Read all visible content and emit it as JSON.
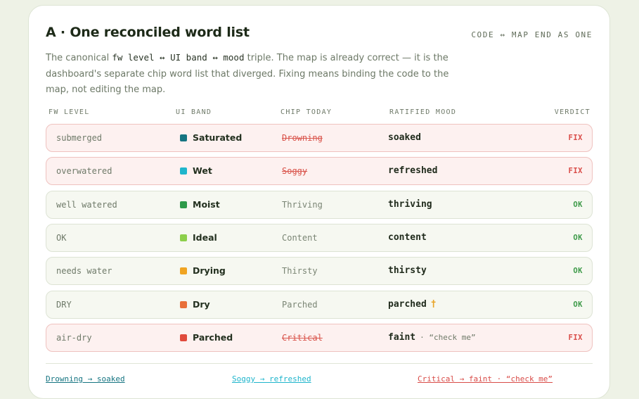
{
  "title": "A · One reconciled word list",
  "tagline": "CODE ↔ MAP END AS ONE",
  "description": {
    "pre": "The canonical ",
    "code": "fw level ↔ UI band ↔ mood",
    "post": " triple. The map is already correct — it is the dashboard's separate chip word list that diverged. Fixing means binding the code to the map, not editing the map."
  },
  "columns": {
    "fw_level": "FW LEVEL",
    "ui_band": "UI BAND",
    "chip_today": "CHIP TODAY",
    "ratified_mood": "RATIFIED MOOD",
    "verdict": "VERDICT"
  },
  "rows": [
    {
      "fw": "submerged",
      "band": "Saturated",
      "color": "#157481",
      "chip": "Drowning",
      "mood": "soaked",
      "extra": "",
      "note": "",
      "verdict": "FIX"
    },
    {
      "fw": "overwatered",
      "band": "Wet",
      "color": "#1fb5cc",
      "chip": "Soggy",
      "mood": "refreshed",
      "extra": "",
      "note": "",
      "verdict": "FIX"
    },
    {
      "fw": "well watered",
      "band": "Moist",
      "color": "#2e9a4a",
      "chip": "Thriving",
      "mood": "thriving",
      "extra": "",
      "note": "",
      "verdict": "OK"
    },
    {
      "fw": "OK",
      "band": "Ideal",
      "color": "#8ccf4b",
      "chip": "Content",
      "mood": "content",
      "extra": "",
      "note": "",
      "verdict": "OK"
    },
    {
      "fw": "needs water",
      "band": "Drying",
      "color": "#f0a422",
      "chip": "Thirsty",
      "mood": "thirsty",
      "extra": "",
      "note": "",
      "verdict": "OK"
    },
    {
      "fw": "DRY",
      "band": "Dry",
      "color": "#e8703a",
      "chip": "Parched",
      "mood": "parched",
      "extra": "†",
      "note": "",
      "verdict": "OK"
    },
    {
      "fw": "air-dry",
      "band": "Parched",
      "color": "#e04a3c",
      "chip": "Critical",
      "mood": "faint",
      "extra": "",
      "note": "· “check me”",
      "verdict": "FIX"
    }
  ],
  "footer": [
    {
      "text": "Drowning → soaked",
      "color": "#157481"
    },
    {
      "text": "Soggy → refreshed",
      "color": "#1fb5cc"
    },
    {
      "text": "Critical → faint · “check me”",
      "color": "#d94c48"
    }
  ]
}
